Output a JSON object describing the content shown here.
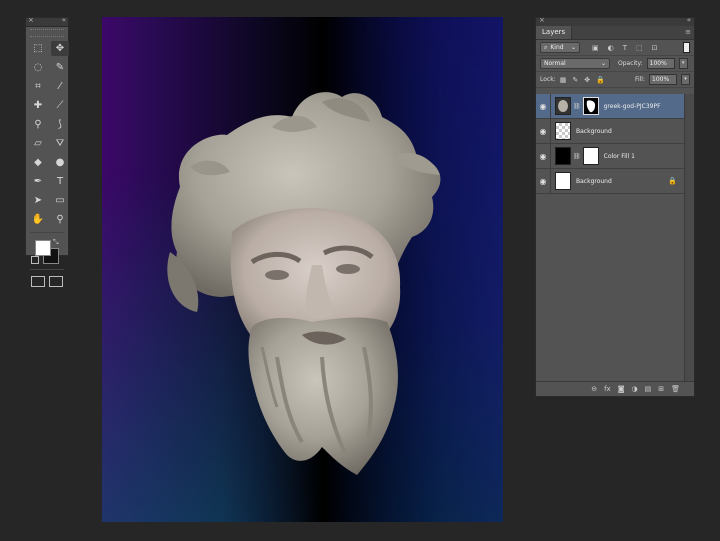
{
  "tools_panel": {
    "close_glyph": "×",
    "collapse_glyph": "«",
    "tools": [
      {
        "icon": "marquee-icon",
        "glyph": "⬚"
      },
      {
        "icon": "move-icon",
        "glyph": "✥"
      },
      {
        "icon": "lasso-icon",
        "glyph": "◌"
      },
      {
        "icon": "magic-wand-icon",
        "glyph": "✎"
      },
      {
        "icon": "crop-icon",
        "glyph": "⌗"
      },
      {
        "icon": "eyedropper-icon",
        "glyph": "⁄"
      },
      {
        "icon": "healing-brush-icon",
        "glyph": "✚"
      },
      {
        "icon": "brush-icon",
        "glyph": "⟋"
      },
      {
        "icon": "stamp-icon",
        "glyph": "⚲"
      },
      {
        "icon": "history-brush-icon",
        "glyph": "⟆"
      },
      {
        "icon": "eraser-icon",
        "glyph": "▱"
      },
      {
        "icon": "paint-bucket-icon",
        "glyph": "⛛"
      },
      {
        "icon": "blur-icon",
        "glyph": "◆"
      },
      {
        "icon": "dodge-icon",
        "glyph": "●"
      },
      {
        "icon": "pen-icon",
        "glyph": "✒"
      },
      {
        "icon": "type-icon",
        "glyph": "T"
      },
      {
        "icon": "path-selection-icon",
        "glyph": "➤"
      },
      {
        "icon": "rectangle-icon",
        "glyph": "▭"
      },
      {
        "icon": "hand-icon",
        "glyph": "✋"
      },
      {
        "icon": "zoom-icon",
        "glyph": "⚲"
      }
    ],
    "foreground_color": "#ffffff",
    "background_color": "#111111"
  },
  "layers_panel": {
    "close_glyph": "×",
    "collapse_glyph": "«",
    "tab_label": "Layers",
    "menu_glyph": "≡",
    "filter": {
      "value": "Kind",
      "icons": [
        "▣",
        "◐",
        "T",
        "⬚",
        "⊡"
      ]
    },
    "blend_mode": "Normal",
    "opacity_label": "Opacity:",
    "opacity_value": "100%",
    "lock_label": "Lock:",
    "lock_icons": [
      "▦",
      "✎",
      "✥",
      "🔒"
    ],
    "fill_label": "Fill:",
    "fill_value": "100%",
    "layers": [
      {
        "name": "greek-god-PJC39PF",
        "visible": true,
        "selected": true,
        "thumb": "statue",
        "mask": true
      },
      {
        "name": "Background",
        "visible": true,
        "selected": false,
        "thumb": "checker",
        "mask": false
      },
      {
        "name": "Color Fill 1",
        "visible": true,
        "selected": false,
        "thumb": "black",
        "mask": true
      },
      {
        "name": "Background",
        "visible": true,
        "selected": false,
        "thumb": "white",
        "mask": false,
        "locked": true
      }
    ],
    "footer_icons": [
      "⊖",
      "fx",
      "◙",
      "◑",
      "▤",
      "⊞",
      "🗑"
    ]
  },
  "colors": {
    "app_background": "#262626",
    "panel": "#535353",
    "selected_layer": "#536a8a"
  }
}
